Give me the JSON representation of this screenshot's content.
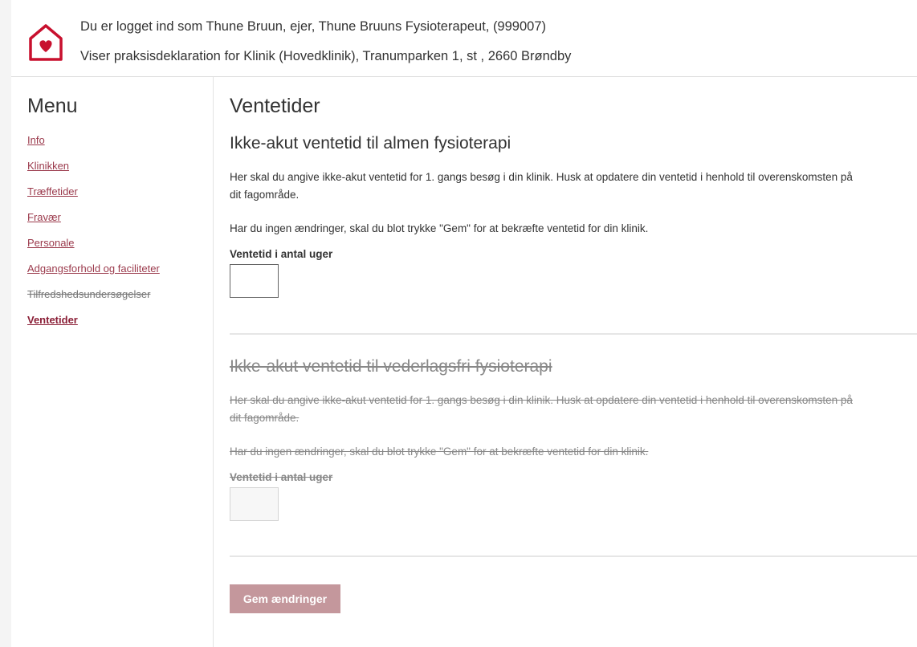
{
  "header": {
    "logged_in_line": "Du er logget ind som Thune Bruun, ejer, Thune Bruuns Fysioterapeut, (999007)",
    "viewing_line": "Viser praksisdeklaration for Klinik (Hovedklinik), Tranumparken 1, st , 2660 Brøndby",
    "logo_icon": "house-heart-icon",
    "brand_color": "#c8102e"
  },
  "sidebar": {
    "title": "Menu",
    "items": [
      {
        "label": "Info"
      },
      {
        "label": "Klinikken"
      },
      {
        "label": "Træffetider"
      },
      {
        "label": "Fravær"
      },
      {
        "label": "Personale"
      },
      {
        "label": "Adgangsforhold og faciliteter"
      },
      {
        "label": "Tilfredshedsundersøgelser"
      },
      {
        "label": "Ventetider"
      }
    ]
  },
  "main": {
    "title": "Ventetider",
    "section1": {
      "title": "Ikke-akut ventetid til almen fysioterapi",
      "para1": "Her skal du angive ikke-akut ventetid for 1. gangs besøg i din klinik. Husk at opdatere din ventetid i henhold til overenskomsten på dit fagområde.",
      "para2": "Har du ingen ændringer, skal du blot trykke \"Gem\" for at bekræfte ventetid for din klinik.",
      "field_label": "Ventetid i antal uger",
      "field_value": ""
    },
    "section2": {
      "title": "Ikke-akut ventetid til vederlagsfri fysioterapi",
      "para1": "Her skal du angive ikke-akut ventetid for 1. gangs besøg i din klinik. Husk at opdatere din ventetid i henhold til overenskomsten på dit fagområde.",
      "para2": "Har du ingen ændringer, skal du blot trykke \"Gem\" for at bekræfte ventetid for din klinik.",
      "field_label": "Ventetid i antal uger",
      "field_value": ""
    },
    "save_label": "Gem ændringer"
  },
  "colors": {
    "link": "#9b3a4c",
    "active_link": "#8a1e36",
    "button": "#c4979c"
  }
}
